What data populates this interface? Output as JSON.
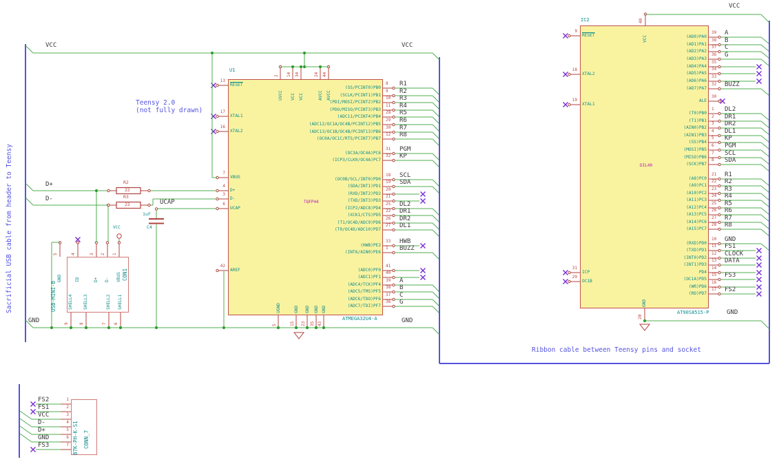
{
  "notes": {
    "teensy_line1": "Teensy 2.0",
    "teensy_line2": "(not fully drawn)",
    "usb_cable": "Sacrificial USB cable from header to Teensy",
    "ribbon": "Ribbon cable between Teensy pins and socket"
  },
  "labels": {
    "vcc_left": "VCC",
    "vcc_right": "VCC",
    "vcc_top_right": "VCC",
    "gnd_left": "GND",
    "gnd_right": "GND",
    "gnd_bottom_right": "GND",
    "d_plus": "D+",
    "d_minus": "D-",
    "ucap": "UCAP",
    "con1_vcc_symbol": "VCC"
  },
  "u1": {
    "ref": "U1",
    "value": "ATMEGA32U4-A",
    "package": "TQFP44",
    "left_pins": [
      {
        "n": "13",
        "name": "RESET",
        "c": "nc",
        "ov": true
      },
      {
        "n": "17",
        "name": "XTAL1",
        "c": "nc"
      },
      {
        "n": "16",
        "name": "XTAL2",
        "c": "nc"
      },
      {
        "n": "7",
        "name": "VBUS",
        "c": "w"
      },
      {
        "n": "4",
        "name": "D+",
        "c": "w"
      },
      {
        "n": "3",
        "name": "D-",
        "c": "w"
      },
      {
        "n": "6",
        "name": "UCAP",
        "c": "w"
      },
      {
        "n": "42",
        "name": "AREF",
        "c": "w"
      }
    ],
    "top_pins": [
      {
        "n": "2",
        "name": "UVCC"
      },
      {
        "n": "14",
        "name": "VCC"
      },
      {
        "n": "34",
        "name": "VCC"
      },
      {
        "n": "24",
        "name": "AVCC"
      },
      {
        "n": "44",
        "name": "AVCC"
      }
    ],
    "bottom_pins": [
      {
        "n": "5",
        "name": "UGND"
      },
      {
        "n": "15",
        "name": "GND"
      },
      {
        "n": "23",
        "name": "GND"
      },
      {
        "n": "35",
        "name": "GND"
      },
      {
        "n": "43",
        "name": "GND"
      }
    ],
    "right_pins": [
      {
        "n": "8",
        "name": "(SS/PCINT0)PB0",
        "net": "R1",
        "c": "bus"
      },
      {
        "n": "9",
        "name": "(SCLK/PCINT1)PB1",
        "net": "R2",
        "c": "bus"
      },
      {
        "n": "10",
        "name": "(PDI/MOSI/PCINT2)PB2",
        "net": "R3",
        "c": "bus"
      },
      {
        "n": "11",
        "name": "(PDO/MISO/PCINT3)PB3",
        "net": "R4",
        "c": "bus"
      },
      {
        "n": "28",
        "name": "(ADC11/PCINT4)PB4",
        "net": "R5",
        "c": "bus"
      },
      {
        "n": "29",
        "name": "(ADC12/OC1A/OC4B/PCINT12)PB5",
        "net": "R6",
        "c": "bus"
      },
      {
        "n": "30",
        "name": "(ADC13/OC1B/OC4B/PCINT13)PB6",
        "net": "R7",
        "c": "bus"
      },
      {
        "n": "12",
        "name": "(OC0A/OC1C/RTS/PCINT7)PB7",
        "net": "R8",
        "c": "bus"
      },
      {
        "n": "31",
        "name": "(OC3A/OC4A)PC6",
        "net": "PGM",
        "c": "bus"
      },
      {
        "n": "32",
        "name": "(ICP3/CLK0/OC4A)PC7",
        "net": "KP",
        "c": "bus"
      },
      {
        "n": "18",
        "name": "(OC0B/SCL/INT0)PD0",
        "net": "SCL",
        "c": "bus"
      },
      {
        "n": "19",
        "name": "(SDA/INT1)PD1",
        "net": "SDA",
        "c": "bus"
      },
      {
        "n": "20",
        "name": "(RXD/INT2)PD2",
        "net": "",
        "c": "ncwire"
      },
      {
        "n": "21",
        "name": "(TXD/INT3)PD3",
        "net": "",
        "c": "ncwire"
      },
      {
        "n": "25",
        "name": "(ICP2/ADC8)PD4",
        "net": "DL2",
        "c": "bus"
      },
      {
        "n": "22",
        "name": "(XCK1/CTS)PD5",
        "net": "DR1",
        "c": "bus"
      },
      {
        "n": "26",
        "name": "(T1/OC4D/ADC9)PD6",
        "net": "DR2",
        "c": "bus"
      },
      {
        "n": "27",
        "name": "(T0/OC4D/ADC10)PD7",
        "net": "DL1",
        "c": "bus"
      },
      {
        "n": "33",
        "name": "(HWB)PE2",
        "net": "HWB",
        "c": "nclabel"
      },
      {
        "n": "1",
        "name": "(INT6/AIN0)PE6",
        "net": "BUZZ",
        "c": "bus"
      },
      {
        "n": "41",
        "name": "(ADC0)PF0",
        "net": "",
        "c": "ncwire"
      },
      {
        "n": "40",
        "name": "(ADC1)PF1",
        "net": "",
        "c": "ncwire"
      },
      {
        "n": "39",
        "name": "(ADC4/TCK)PF4",
        "net": "A",
        "c": "bus"
      },
      {
        "n": "38",
        "name": "(ADC5/TMS)PF5",
        "net": "B",
        "c": "bus"
      },
      {
        "n": "37",
        "name": "(ADC6/TDO)PF6",
        "net": "C",
        "c": "bus"
      },
      {
        "n": "36",
        "name": "(ADC7/TDI)PF7",
        "net": "G",
        "c": "bus"
      }
    ]
  },
  "ic2": {
    "ref": "IC2",
    "value": "AT90S8515-P",
    "package": "DIL40",
    "left_pins": [
      {
        "n": "9",
        "name": "RESET",
        "c": "nc",
        "ov": true
      },
      {
        "n": "18",
        "name": "XTAL2",
        "c": "nc"
      },
      {
        "n": "19",
        "name": "XTAL1",
        "c": "nc"
      },
      {
        "n": "31",
        "name": "ICP",
        "c": "nc"
      },
      {
        "n": "29",
        "name": "OC1B",
        "c": "nc"
      }
    ],
    "top_pin": {
      "n": "40",
      "name": "VCC"
    },
    "bottom_pin": {
      "n": "20",
      "name": "GND"
    },
    "right_pins": [
      {
        "n": "39",
        "name": "(AD0)PA0",
        "net": "A",
        "c": "bus"
      },
      {
        "n": "38",
        "name": "(AD1)PA1",
        "net": "B",
        "c": "bus"
      },
      {
        "n": "37",
        "name": "(AD2)PA2",
        "net": "C",
        "c": "bus"
      },
      {
        "n": "36",
        "name": "(AD3)PA3",
        "net": "G",
        "c": "bus"
      },
      {
        "n": "35",
        "name": "(AD4)PA4",
        "net": "",
        "c": "ncwire"
      },
      {
        "n": "34",
        "name": "(AD5)PA5",
        "net": "",
        "c": "ncwire"
      },
      {
        "n": "33",
        "name": "(AD6)PA6",
        "net": "",
        "c": "ncwire"
      },
      {
        "n": "32",
        "name": "(AD7)PA7",
        "net": "BUZZ",
        "c": "bus"
      },
      {
        "n": "30",
        "name": "ALE",
        "net": "",
        "c": "ncpin"
      },
      {
        "n": "1",
        "name": "(T0)PB0",
        "net": "DL2",
        "c": "bus"
      },
      {
        "n": "2",
        "name": "(T1)PB1",
        "net": "DR1",
        "c": "bus"
      },
      {
        "n": "3",
        "name": "(AIN0)PB2",
        "net": "DR2",
        "c": "bus"
      },
      {
        "n": "4",
        "name": "(AIN1)PB3",
        "net": "DL1",
        "c": "bus"
      },
      {
        "n": "5",
        "name": "(SS)PB4",
        "net": "KP",
        "c": "bus"
      },
      {
        "n": "6",
        "name": "(MOSI)PB5",
        "net": "PGM",
        "c": "bus"
      },
      {
        "n": "7",
        "name": "(MISO)PB6",
        "net": "SCL",
        "c": "bus"
      },
      {
        "n": "8",
        "name": "(SCK)PB7",
        "net": "SDA",
        "c": "bus"
      },
      {
        "n": "21",
        "name": "(A8)PC0",
        "net": "R1",
        "c": "bus"
      },
      {
        "n": "22",
        "name": "(A9)PC1",
        "net": "R2",
        "c": "bus"
      },
      {
        "n": "23",
        "name": "(A10)PC2",
        "net": "R3",
        "c": "bus"
      },
      {
        "n": "24",
        "name": "(A11)PC3",
        "net": "R4",
        "c": "bus"
      },
      {
        "n": "25",
        "name": "(A12)PC4",
        "net": "R5",
        "c": "bus"
      },
      {
        "n": "26",
        "name": "(A13)PC5",
        "net": "R6",
        "c": "bus"
      },
      {
        "n": "27",
        "name": "(A14)PC6",
        "net": "R7",
        "c": "bus"
      },
      {
        "n": "28",
        "name": "(A15)PC7",
        "net": "R8",
        "c": "bus"
      },
      {
        "n": "10",
        "name": "(RXD)PD0",
        "net": "GND",
        "c": "bus"
      },
      {
        "n": "11",
        "name": "(TXD)PD1",
        "net": "FS1",
        "c": "nclabel"
      },
      {
        "n": "12",
        "name": "(INT0)PD2",
        "net": "CLOCK",
        "c": "nclabel"
      },
      {
        "n": "13",
        "name": "(INT1)PD3",
        "net": "DATA",
        "c": "nclabel"
      },
      {
        "n": "14",
        "name": "PD4",
        "net": "",
        "c": "ncwire"
      },
      {
        "n": "15",
        "name": "(OC1A)PD5",
        "net": "FS3",
        "c": "nclabel"
      },
      {
        "n": "16",
        "name": "(WR)PD6",
        "net": "",
        "c": "ncwire"
      },
      {
        "n": "17",
        "name": "(RD)PD7",
        "net": "FS2",
        "c": "nclabel"
      }
    ]
  },
  "con1": {
    "ref": "CON1",
    "value": "USB-MINI-B",
    "top_pins": [
      {
        "n": "5",
        "name": "GND"
      },
      {
        "n": "4",
        "name": "ID"
      },
      {
        "n": "3",
        "name": "D+"
      },
      {
        "n": "2",
        "name": "D-"
      },
      {
        "n": "1",
        "name": "VBUS"
      }
    ],
    "bottom_pins": [
      {
        "n": "9",
        "name": "SHELL4"
      },
      {
        "n": "8",
        "name": "SHELL3"
      },
      {
        "n": "7",
        "name": "SHELL2"
      },
      {
        "n": "6",
        "name": "SHELL1"
      }
    ]
  },
  "conn7": {
    "ref": "CONN_7",
    "value": "B7K-PH-K-S1",
    "pins": [
      {
        "n": "1",
        "net": "FS2",
        "c": "nc"
      },
      {
        "n": "2",
        "net": "FS1",
        "c": "nc"
      },
      {
        "n": "3",
        "net": "VCC",
        "c": "bus"
      },
      {
        "n": "4",
        "net": "D-",
        "c": "bus"
      },
      {
        "n": "5",
        "net": "D+",
        "c": "bus"
      },
      {
        "n": "6",
        "net": "GND",
        "c": "bus"
      },
      {
        "n": "7",
        "net": "FS3",
        "c": "nc"
      }
    ]
  },
  "r2": {
    "ref": "R2",
    "value": "22"
  },
  "r3": {
    "ref": "R3",
    "value": "22"
  },
  "c4": {
    "ref": "C4",
    "value": "1uF"
  },
  "colors": {
    "wire": "#4fae4f",
    "junction": "#2f9e2f",
    "pin": "#b0433e",
    "symbol_fill": "#f9f3a0",
    "symbol_border": "#c0504b",
    "pin_name": "#0f8b8b",
    "pin_number": "#c0433e",
    "net_label": "#383838",
    "no_connect": "#7b2fd6",
    "bus_blue": "#5552dd",
    "annotation_blue": "#5453e0",
    "package_magenta": "#b517b5"
  }
}
